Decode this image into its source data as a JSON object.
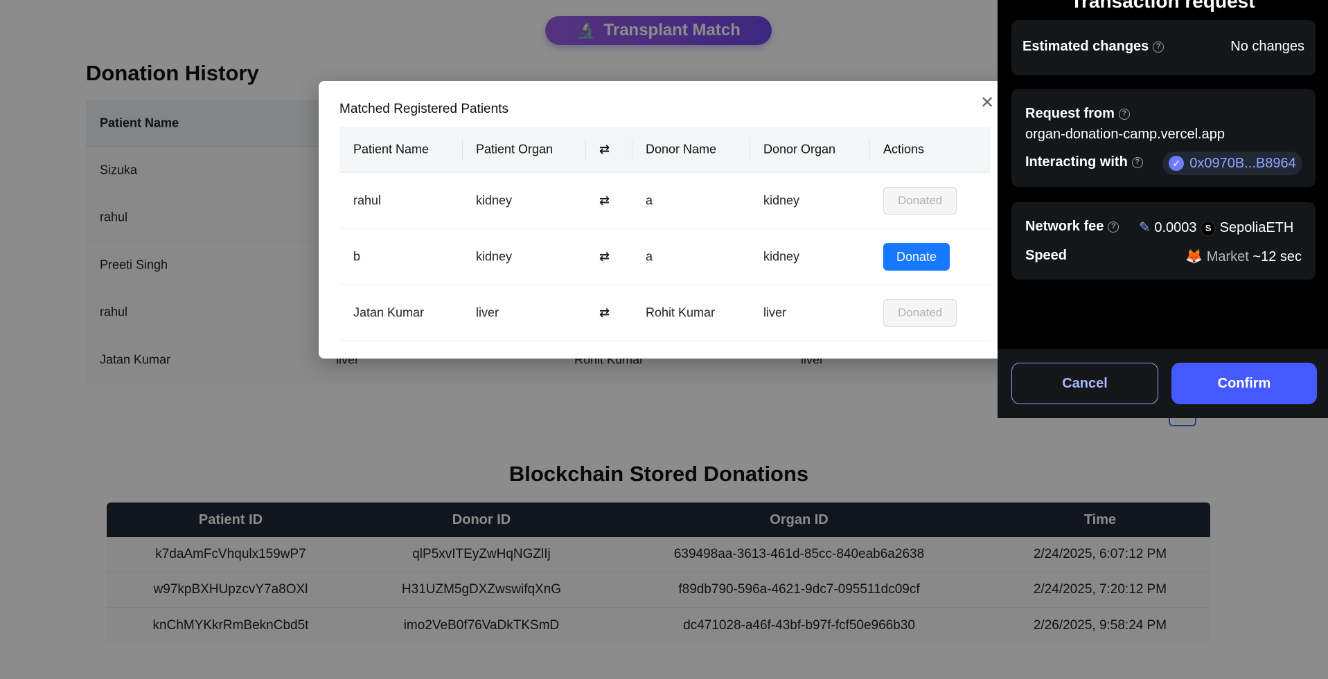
{
  "header": {
    "app_button_label": "Transplant Match",
    "app_button_icon": "microscope-icon"
  },
  "donation_history": {
    "title": "Donation History",
    "columns": [
      "Patient Name",
      "",
      "",
      ""
    ],
    "rows": [
      [
        "Sizuka",
        "",
        "",
        ""
      ],
      [
        "rahul",
        "",
        "",
        ""
      ],
      [
        "Preeti Singh",
        "",
        "",
        ""
      ],
      [
        "rahul",
        "",
        "",
        ""
      ],
      [
        "Jatan Kumar",
        "liver",
        "Rohit Kumar",
        "liver"
      ]
    ]
  },
  "blockchain": {
    "title": "Blockchain Stored Donations",
    "columns": [
      "Patient ID",
      "Donor ID",
      "Organ ID",
      "Time"
    ],
    "rows": [
      [
        "k7daAmFcVhqulx159wP7",
        "qlP5xvITEyZwHqNGZlIj",
        "639498aa-3613-461d-85cc-840eab6a2638",
        "2/24/2025, 6:07:12 PM"
      ],
      [
        "w97kpBXHUpzcvY7a8OXl",
        "H31UZM5gDXZwswifqXnG",
        "f89db790-596a-4621-9dc7-095511dc09cf",
        "2/24/2025, 7:20:12 PM"
      ],
      [
        "knChMYKkrRmBeknCbd5t",
        "imo2VeB0f76VaDkTKSmD",
        "dc471028-a46f-43bf-b97f-fcf50e966b30",
        "2/26/2025, 9:58:24 PM"
      ]
    ]
  },
  "modal": {
    "title": "Matched Registered Patients",
    "close_icon": "close-icon",
    "columns": [
      "Patient Name",
      "Patient Organ",
      "⇄",
      "Donor Name",
      "Donor Organ",
      "Actions"
    ],
    "rows": [
      {
        "patient": "rahul",
        "patient_organ": "kidney",
        "swap": "⇄",
        "donor": "a",
        "donor_organ": "kidney",
        "action": "Donated"
      },
      {
        "patient": "b",
        "patient_organ": "kidney",
        "swap": "⇄",
        "donor": "a",
        "donor_organ": "kidney",
        "action": "Donate"
      },
      {
        "patient": "Jatan Kumar",
        "patient_organ": "liver",
        "swap": "⇄",
        "donor": "Rohit Kumar",
        "donor_organ": "liver",
        "action": "Donated"
      }
    ]
  },
  "wallet": {
    "title": "Transaction request",
    "estimated_changes_label": "Estimated changes",
    "estimated_changes_value": "No changes",
    "request_from_label": "Request from",
    "request_from_value": "organ-donation-camp.vercel.app",
    "interacting_with_label": "Interacting with",
    "interacting_with_value": "0x0970B...B8964",
    "network_fee_label": "Network fee",
    "network_fee_value": "0.0003",
    "network_token_badge": "S",
    "network_token": "SepoliaETH",
    "speed_label": "Speed",
    "speed_value": "Market",
    "speed_time": "~12 sec",
    "cancel_label": "Cancel",
    "confirm_label": "Confirm",
    "help_glyph": "?"
  }
}
